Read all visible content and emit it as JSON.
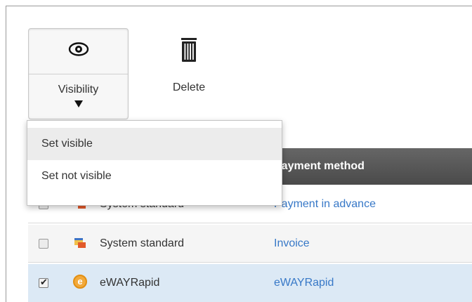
{
  "toolbar": {
    "visibility_label": "Visibility",
    "visibility_icon": "eye-icon",
    "delete_label": "Delete",
    "delete_icon": "trash-icon"
  },
  "menu": {
    "items": [
      {
        "label": "Set visible",
        "highlighted": true
      },
      {
        "label": "Set not visible",
        "highlighted": false
      }
    ]
  },
  "table": {
    "columns": {
      "payment_method": "Payment method"
    },
    "rows": [
      {
        "checked": false,
        "icon": "status-standard-icon",
        "name": "System standard",
        "payment": "Payment in advance"
      },
      {
        "checked": false,
        "icon": "status-standard-icon",
        "name": "System standard",
        "payment": "Invoice"
      },
      {
        "checked": true,
        "icon": "eway-icon",
        "name": "eWAYRapid",
        "payment": "eWAYRapid"
      }
    ]
  },
  "colors": {
    "header_bg": "#555555",
    "link": "#3778c7",
    "selected_row": "#dce9f5",
    "menu_hover": "#ececec"
  }
}
